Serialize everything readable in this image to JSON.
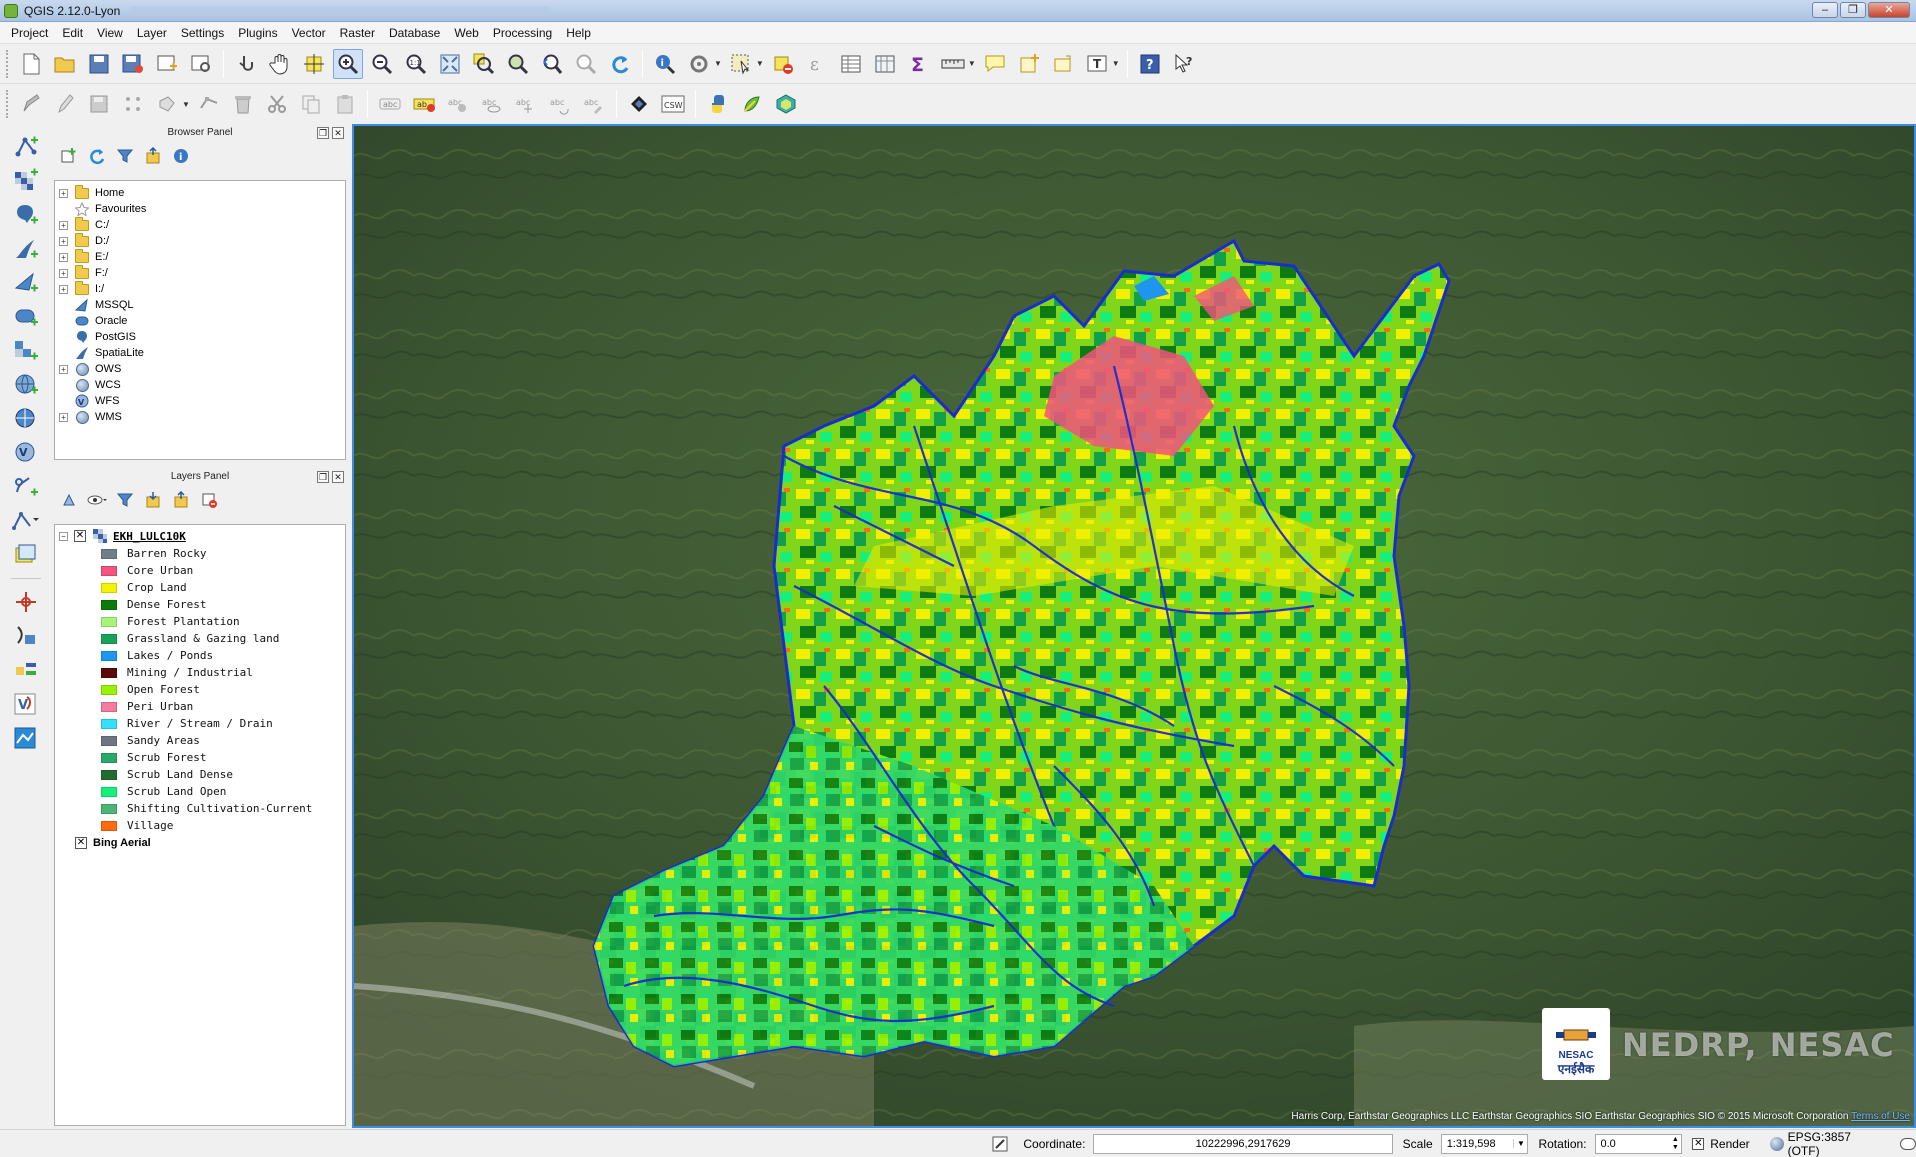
{
  "window": {
    "title": "QGIS 2.12.0-Lyon"
  },
  "menu": [
    "Project",
    "Edit",
    "View",
    "Layer",
    "Settings",
    "Plugins",
    "Vector",
    "Raster",
    "Database",
    "Web",
    "Processing",
    "Help"
  ],
  "browser_panel": {
    "title": "Browser Panel",
    "items": [
      "Home",
      "Favourites",
      "C:/",
      "D:/",
      "E:/",
      "F:/",
      "I:/",
      "MSSQL",
      "Oracle",
      "PostGIS",
      "SpatiaLite",
      "OWS",
      "WCS",
      "WFS",
      "WMS"
    ]
  },
  "layers_panel": {
    "title": "Layers Panel",
    "layer_name": "EKH_LULC10K",
    "legend": [
      {
        "label": "Barren Rocky",
        "color": "#6e7f8a"
      },
      {
        "label": "Core Urban",
        "color": "#f2547f"
      },
      {
        "label": "Crop Land",
        "color": "#f5f200"
      },
      {
        "label": "Dense Forest",
        "color": "#0b7a0b"
      },
      {
        "label": "Forest Plantation",
        "color": "#a6f57a"
      },
      {
        "label": "Grassland & Gazing land",
        "color": "#18a35a"
      },
      {
        "label": "Lakes / Ponds",
        "color": "#1e96f0"
      },
      {
        "label": "Mining / Industrial",
        "color": "#5a0a0a"
      },
      {
        "label": "Open Forest",
        "color": "#9bf200"
      },
      {
        "label": "Peri Urban",
        "color": "#f77aa0"
      },
      {
        "label": "River / Stream / Drain",
        "color": "#33e0ff"
      },
      {
        "label": "Sandy Areas",
        "color": "#6f7580"
      },
      {
        "label": "Scrub Forest",
        "color": "#2aa86a"
      },
      {
        "label": "Scrub Land Dense",
        "color": "#1f6e2e"
      },
      {
        "label": "Scrub Land Open",
        "color": "#16f07a"
      },
      {
        "label": "Shifting Cultivation-Current",
        "color": "#4bb578"
      },
      {
        "label": "Village",
        "color": "#ff6a10"
      }
    ],
    "basemap": "Bing Aerial"
  },
  "map": {
    "watermark": "NEDRP, NESAC",
    "logo_text": "NESAC",
    "logo_hindi": "एनईसैक",
    "attribution": "Harris Corp, Earthstar Geographics LLC Earthstar Geographics SIO Earthstar Geographics SIO © 2015 Microsoft Corporation",
    "terms": "Terms of Use"
  },
  "status": {
    "coordinate_label": "Coordinate:",
    "coordinate_value": "10222996,2917629",
    "scale_label": "Scale",
    "scale_value": "1:319,598",
    "rotation_label": "Rotation:",
    "rotation_value": "0.0",
    "render_label": "Render",
    "crs": "EPSG:3857 (OTF)"
  }
}
